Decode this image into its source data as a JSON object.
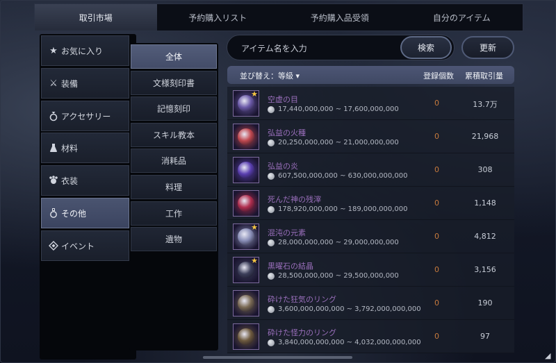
{
  "tabs": [
    {
      "label": "取引市場",
      "active": true
    },
    {
      "label": "予約購入リスト",
      "active": false
    },
    {
      "label": "予約購入品受領",
      "active": false
    },
    {
      "label": "自分のアイテム",
      "active": false
    }
  ],
  "categories": [
    {
      "label": "お気に入り",
      "icon": "star-icon"
    },
    {
      "label": "装備",
      "icon": "crossed-swords-icon"
    },
    {
      "label": "アクセサリー",
      "icon": "ring-icon"
    },
    {
      "label": "材料",
      "icon": "flask-icon"
    },
    {
      "label": "衣装",
      "icon": "costume-icon"
    },
    {
      "label": "その他",
      "icon": "potion-icon",
      "active": true
    },
    {
      "label": "イベント",
      "icon": "event-diamond-icon"
    }
  ],
  "subcategories": [
    {
      "label": "全体",
      "active": true
    },
    {
      "label": "文様刻印書"
    },
    {
      "label": "記憶刻印"
    },
    {
      "label": "スキル教本"
    },
    {
      "label": "消耗品"
    },
    {
      "label": "料理"
    },
    {
      "label": "工作"
    },
    {
      "label": "遺物"
    }
  ],
  "search": {
    "placeholder": "アイテム名を入力",
    "search_label": "検索",
    "refresh_label": "更新"
  },
  "list_header": {
    "sort_label": "並び替え：等級 ▾",
    "count_label": "登録個数",
    "total_label": "累積取引量"
  },
  "items": [
    {
      "name": "空虚の目",
      "price": "17,440,000,000 ~ 17,600,000,000",
      "count": "0",
      "total": "13.7万",
      "starred": true,
      "icon_color": "#6b5aa8"
    },
    {
      "name": "弘益の火種",
      "price": "20,250,000,000 ~ 21,000,000,000",
      "count": "0",
      "total": "21,968",
      "starred": false,
      "icon_color": "#c0484f"
    },
    {
      "name": "弘益の炎",
      "price": "607,500,000,000 ~ 630,000,000,000",
      "count": "0",
      "total": "308",
      "starred": false,
      "icon_color": "#5a3fb0"
    },
    {
      "name": "死んだ神の残滓",
      "price": "178,920,000,000 ~ 189,000,000,000",
      "count": "0",
      "total": "1,148",
      "starred": false,
      "icon_color": "#b02e4e"
    },
    {
      "name": "混沌の元素",
      "price": "28,000,000,000 ~ 29,000,000,000",
      "count": "0",
      "total": "4,812",
      "starred": true,
      "icon_color": "#8a8fb8"
    },
    {
      "name": "黒曜石の結晶",
      "price": "28,500,000,000 ~ 29,500,000,000",
      "count": "0",
      "total": "3,156",
      "starred": true,
      "icon_color": "#3c3f5a"
    },
    {
      "name": "砕けた狂気のリング",
      "price": "3,600,000,000,000 ~ 3,792,000,000,000",
      "count": "0",
      "total": "190",
      "starred": false,
      "icon_color": "#7a6a54"
    },
    {
      "name": "砕けた怪力のリング",
      "price": "3,840,000,000,000 ~ 4,032,000,000,000",
      "count": "0",
      "total": "97",
      "starred": false,
      "icon_color": "#6e5a3e"
    }
  ]
}
